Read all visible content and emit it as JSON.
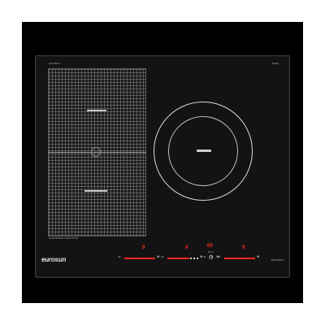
{
  "product": {
    "brand": "eurosun",
    "top_left_mark": "FlexiZone",
    "top_right_mark": "HHEL",
    "bottom_left_note": "FLEXIZONE INDUCTION",
    "bottom_right_note": "EUCM0HS"
  },
  "controls": [
    {
      "zone": "flex-front-left",
      "level_display": "9",
      "level": 1.0,
      "minus": "−",
      "plus": "+"
    },
    {
      "zone": "flex-rear-left",
      "level_display": "6",
      "level": 0.7,
      "minus": "−",
      "plus": "+"
    },
    {
      "zone": "circle-right",
      "level_display": "9",
      "level": 1.0,
      "minus": "−",
      "plus": "+"
    }
  ],
  "timer": {
    "value": "00",
    "label": "timer",
    "buttons": "−  ◷  +"
  },
  "colors": {
    "backdrop": "#000000",
    "glass": "#131313",
    "display": "#ff2a1a",
    "print": "#d9d9d9"
  }
}
